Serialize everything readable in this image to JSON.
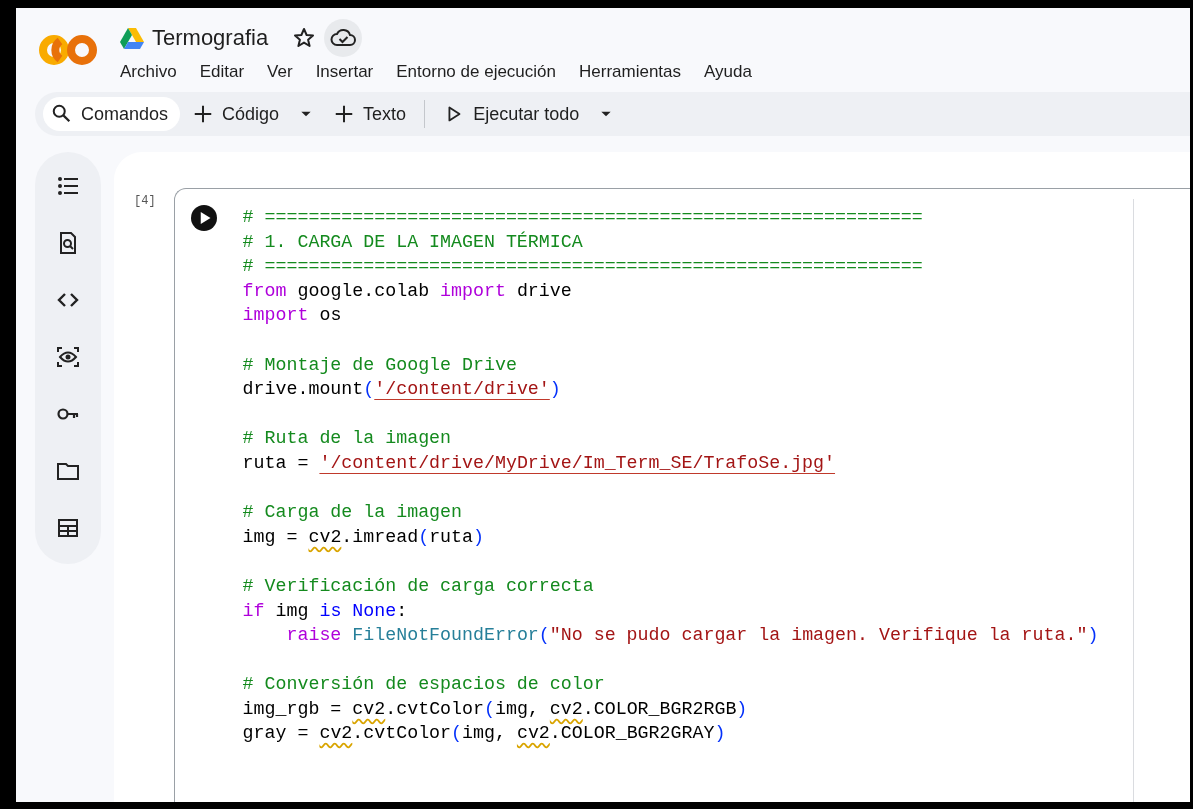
{
  "notebook": {
    "title": "Termografia"
  },
  "menu": [
    "Archivo",
    "Editar",
    "Ver",
    "Insertar",
    "Entorno de ejecución",
    "Herramientas",
    "Ayuda"
  ],
  "toolbar": [
    {
      "kind": "search",
      "label": "Comandos",
      "dropdown": false,
      "divider_before": false
    },
    {
      "kind": "add",
      "label": "Código",
      "dropdown": true,
      "divider_before": false
    },
    {
      "kind": "add",
      "label": "Texto",
      "dropdown": false,
      "divider_before": false
    },
    {
      "kind": "run",
      "label": "Ejecutar todo",
      "dropdown": true,
      "divider_before": true
    }
  ],
  "cell": {
    "execution_count": "[4]",
    "lines": [
      {
        "kind": "code",
        "tokens": [
          {
            "kind": "comment",
            "text": "# ============================================================"
          }
        ]
      },
      {
        "kind": "code",
        "tokens": [
          {
            "kind": "comment",
            "text": "# 1. CARGA DE LA IMAGEN TÉRMICA"
          }
        ]
      },
      {
        "kind": "code",
        "tokens": [
          {
            "kind": "comment",
            "text": "# ============================================================"
          }
        ]
      },
      {
        "kind": "code",
        "tokens": [
          {
            "kind": "keyword",
            "text": "from"
          },
          {
            "kind": "plain",
            "text": " google.colab "
          },
          {
            "kind": "keyword",
            "text": "import"
          },
          {
            "kind": "plain",
            "text": " drive"
          }
        ]
      },
      {
        "kind": "code",
        "tokens": [
          {
            "kind": "keyword",
            "text": "import"
          },
          {
            "kind": "plain",
            "text": " os"
          }
        ]
      },
      {
        "kind": "blank"
      },
      {
        "kind": "code",
        "tokens": [
          {
            "kind": "comment",
            "text": "# Montaje de Google Drive"
          }
        ]
      },
      {
        "kind": "code",
        "tokens": [
          {
            "kind": "plain",
            "text": "drive.mount"
          },
          {
            "kind": "paren",
            "text": "("
          },
          {
            "kind": "string",
            "text": "'/content/drive'",
            "error_underline": true
          },
          {
            "kind": "paren",
            "text": ")"
          }
        ]
      },
      {
        "kind": "blank"
      },
      {
        "kind": "code",
        "tokens": [
          {
            "kind": "comment",
            "text": "# Ruta de la imagen"
          }
        ]
      },
      {
        "kind": "code",
        "tokens": [
          {
            "kind": "plain",
            "text": "ruta = "
          },
          {
            "kind": "string",
            "text": "'/content/drive/MyDrive/Im_Term_SE/TrafoSe.jpg'",
            "error_underline": true
          }
        ]
      },
      {
        "kind": "blank"
      },
      {
        "kind": "code",
        "tokens": [
          {
            "kind": "comment",
            "text": "# Carga de la imagen"
          }
        ]
      },
      {
        "kind": "code",
        "tokens": [
          {
            "kind": "plain",
            "text": "img = "
          },
          {
            "kind": "plain",
            "text": "cv2",
            "warning_squiggle": true
          },
          {
            "kind": "plain",
            "text": ".imread"
          },
          {
            "kind": "paren",
            "text": "("
          },
          {
            "kind": "plain",
            "text": "ruta"
          },
          {
            "kind": "paren",
            "text": ")"
          }
        ]
      },
      {
        "kind": "blank"
      },
      {
        "kind": "code",
        "tokens": [
          {
            "kind": "comment",
            "text": "# Verificación de carga correcta"
          }
        ]
      },
      {
        "kind": "code",
        "tokens": [
          {
            "kind": "keyword",
            "text": "if"
          },
          {
            "kind": "plain",
            "text": " img "
          },
          {
            "kind": "operator",
            "text": "is"
          },
          {
            "kind": "constant",
            "text": " None"
          },
          {
            "kind": "plain",
            "text": ":"
          }
        ]
      },
      {
        "kind": "code",
        "tokens": [
          {
            "kind": "keyword",
            "text": "    raise"
          },
          {
            "kind": "class",
            "text": " FileNotFoundError"
          },
          {
            "kind": "paren",
            "text": "("
          },
          {
            "kind": "string",
            "text": "\"No se pudo cargar la imagen. Verifique la ruta.\""
          },
          {
            "kind": "paren",
            "text": ")"
          }
        ]
      },
      {
        "kind": "blank"
      },
      {
        "kind": "code",
        "tokens": [
          {
            "kind": "comment",
            "text": "# Conversión de espacios de color"
          }
        ]
      },
      {
        "kind": "code",
        "tokens": [
          {
            "kind": "plain",
            "text": "img_rgb = "
          },
          {
            "kind": "plain",
            "text": "cv2",
            "warning_squiggle": true
          },
          {
            "kind": "plain",
            "text": ".cvtColor"
          },
          {
            "kind": "paren",
            "text": "("
          },
          {
            "kind": "plain",
            "text": "img, "
          },
          {
            "kind": "plain",
            "text": "cv2",
            "warning_squiggle": true
          },
          {
            "kind": "plain",
            "text": ".COLOR_BGR2RGB"
          },
          {
            "kind": "paren",
            "text": ")"
          }
        ]
      },
      {
        "kind": "code",
        "tokens": [
          {
            "kind": "plain",
            "text": "gray = "
          },
          {
            "kind": "plain",
            "text": "cv2",
            "warning_squiggle": true
          },
          {
            "kind": "plain",
            "text": ".cvtColor"
          },
          {
            "kind": "paren",
            "text": "("
          },
          {
            "kind": "plain",
            "text": "img, "
          },
          {
            "kind": "plain",
            "text": "cv2",
            "warning_squiggle": true
          },
          {
            "kind": "plain",
            "text": ".COLOR_BGR2GRAY"
          },
          {
            "kind": "paren",
            "text": ")"
          }
        ]
      }
    ]
  }
}
